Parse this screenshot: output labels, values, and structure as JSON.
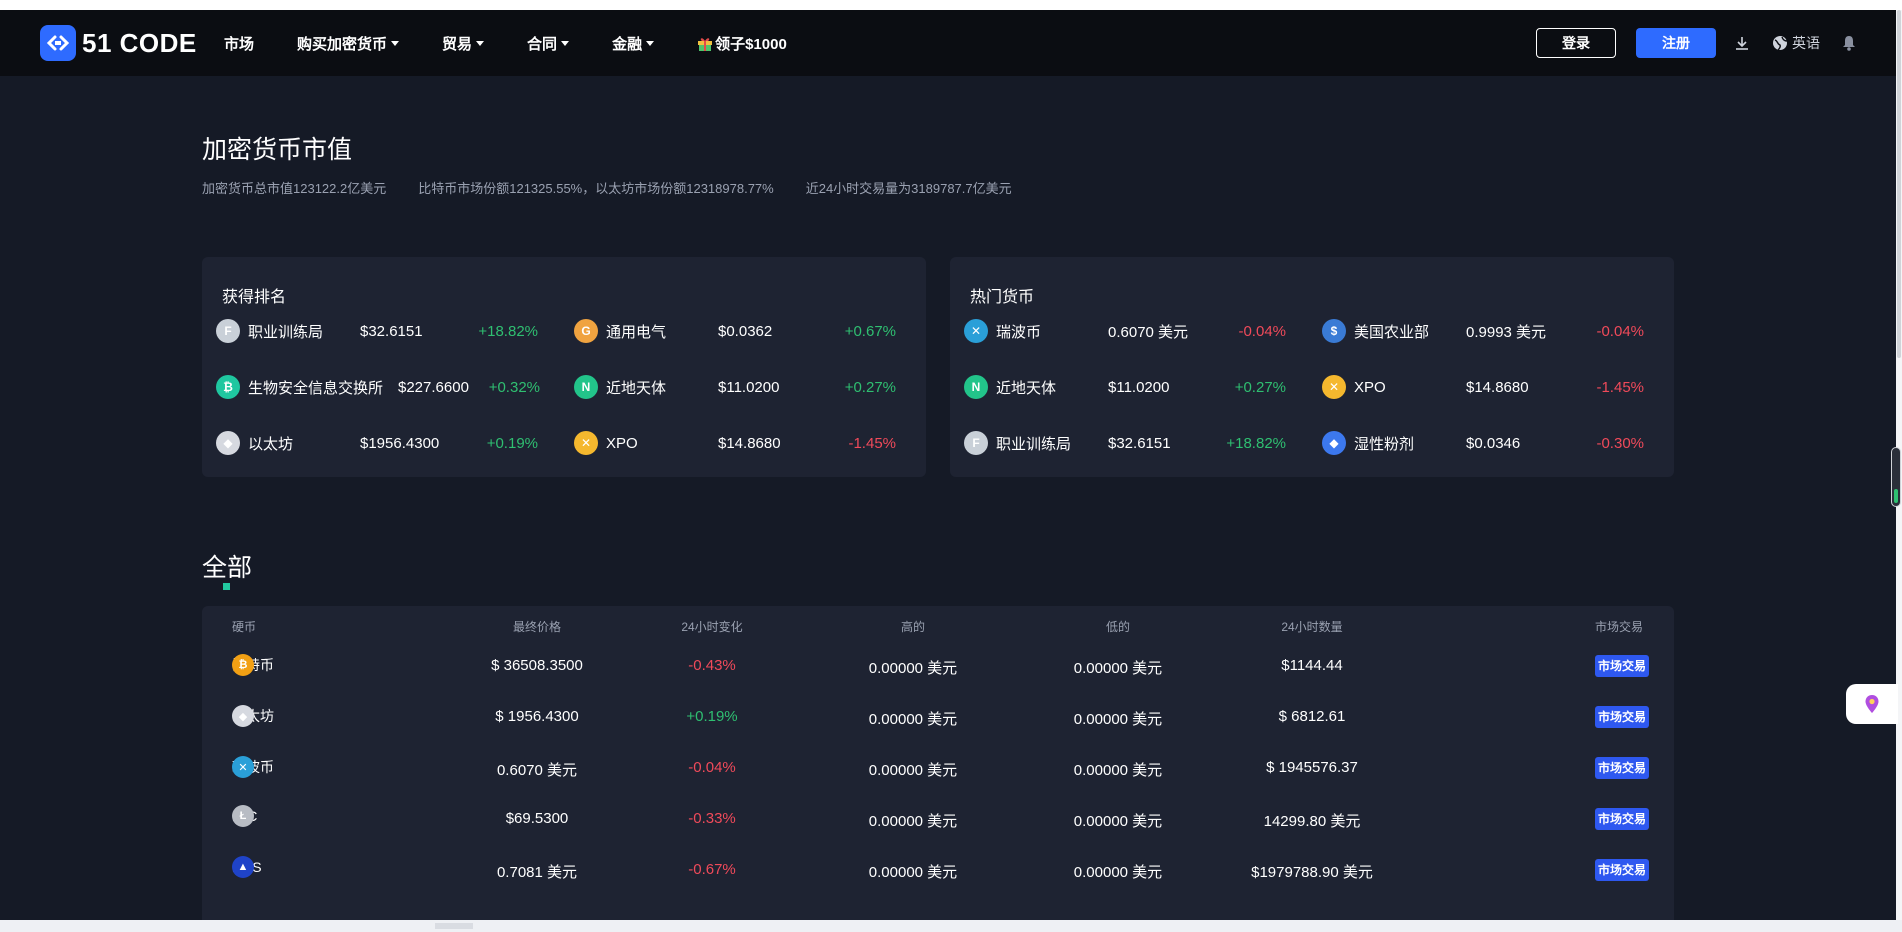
{
  "nav": {
    "logo_text": "51 CODE",
    "menu": [
      {
        "label": "市场",
        "dropdown": false
      },
      {
        "label": "购买加密货币",
        "dropdown": true
      },
      {
        "label": "贸易",
        "dropdown": true
      },
      {
        "label": "合同",
        "dropdown": true
      },
      {
        "label": "金融",
        "dropdown": true
      },
      {
        "label": "领子$1000",
        "dropdown": false,
        "icon": "gift-icon"
      }
    ],
    "login_label": "登录",
    "register_label": "注册",
    "language_label": "英语",
    "accent_color": "#2e6bff"
  },
  "header": {
    "title": "加密货币市值",
    "stats": [
      "加密货币总市值123122.2亿美元",
      "比特币市场份额121325.55%，以太坊市场份额12318978.77%",
      "近24小时交易量为3189787.7亿美元"
    ]
  },
  "gainers": {
    "title": "获得排名",
    "items": [
      {
        "name": "职业训练局",
        "price": "$32.6151",
        "change": "+18.82%",
        "dir": "up",
        "icon": "ftt-icon",
        "color": "#c9d0d8"
      },
      {
        "name": "通用电气",
        "price": "$0.0362",
        "change": "+0.67%",
        "dir": "up",
        "icon": "ge-icon",
        "color": "#f0a340"
      },
      {
        "name": "生物安全信息交换所",
        "price": "$227.6600",
        "change": "+0.32%",
        "dir": "up",
        "icon": "bch-icon",
        "color": "#1fc7a0"
      },
      {
        "name": "近地天体",
        "price": "$11.0200",
        "change": "+0.27%",
        "dir": "up",
        "icon": "neo-icon",
        "color": "#22c48a"
      },
      {
        "name": "以太坊",
        "price": "$1956.4300",
        "change": "+0.19%",
        "dir": "up",
        "icon": "eth-icon",
        "color": "#d6d9e0"
      },
      {
        "name": "XPO",
        "price": "$14.8680",
        "change": "-1.45%",
        "dir": "down",
        "icon": "xpo-icon",
        "color": "#f5b82e"
      }
    ]
  },
  "hot": {
    "title": "热门货币",
    "items": [
      {
        "name": "瑞波币",
        "price": "0.6070 美元",
        "change": "-0.04%",
        "dir": "down",
        "icon": "xrp-icon",
        "color": "#2a9fd8"
      },
      {
        "name": "美国农业部",
        "price": "0.9993 美元",
        "change": "-0.04%",
        "dir": "down",
        "icon": "usdc-icon",
        "color": "#3a7bd5"
      },
      {
        "name": "近地天体",
        "price": "$11.0200",
        "change": "+0.27%",
        "dir": "up",
        "icon": "neo-icon",
        "color": "#22c48a"
      },
      {
        "name": "XPO",
        "price": "$14.8680",
        "change": "-1.45%",
        "dir": "down",
        "icon": "xpo-icon",
        "color": "#f5b82e"
      },
      {
        "name": "职业训练局",
        "price": "$32.6151",
        "change": "+18.82%",
        "dir": "up",
        "icon": "ftt-icon",
        "color": "#c9d0d8"
      },
      {
        "name": "湿性粉剂",
        "price": "$0.0346",
        "change": "-0.30%",
        "dir": "down",
        "icon": "wpt-icon",
        "color": "#3c78ee"
      }
    ]
  },
  "all": {
    "title": "全部",
    "headers": {
      "coin": "硬币",
      "price": "最终价格",
      "change": "24小时变化",
      "high": "高的",
      "low": "低的",
      "volume": "24小时数量",
      "trade": "市场交易"
    },
    "rows": [
      {
        "coin": "比特币",
        "price": "$ 36508.3500",
        "change": "-0.43%",
        "dir": "down",
        "high": "0.00000 美元",
        "low": "0.00000 美元",
        "volume": "$1144.44",
        "trade": "市场交易",
        "icon": "btc-icon",
        "color": "#f2a014"
      },
      {
        "coin": "以太坊",
        "price": "$ 1956.4300",
        "change": "+0.19%",
        "dir": "up",
        "high": "0.00000 美元",
        "low": "0.00000 美元",
        "volume": "$ 6812.61",
        "trade": "市场交易",
        "icon": "eth-icon",
        "color": "#d6d9e0"
      },
      {
        "coin": "瑞波币",
        "price": "0.6070 美元",
        "change": "-0.04%",
        "dir": "down",
        "high": "0.00000 美元",
        "low": "0.00000 美元",
        "volume": "$ 1945576.37",
        "trade": "市场交易",
        "icon": "xrp-icon",
        "color": "#2a9fd8"
      },
      {
        "coin": "LTC",
        "price": "$69.5300",
        "change": "-0.33%",
        "dir": "down",
        "high": "0.00000 美元",
        "low": "0.00000 美元",
        "volume": "14299.80 美元",
        "trade": "市场交易",
        "icon": "ltc-icon",
        "color": "#b8bcc4"
      },
      {
        "coin": "EOS",
        "price": "0.7081 美元",
        "change": "-0.67%",
        "dir": "down",
        "high": "0.00000 美元",
        "low": "0.00000 美元",
        "volume": "$1979788.90 美元",
        "trade": "市场交易",
        "icon": "eos-icon",
        "color": "#1f43c8"
      }
    ]
  }
}
